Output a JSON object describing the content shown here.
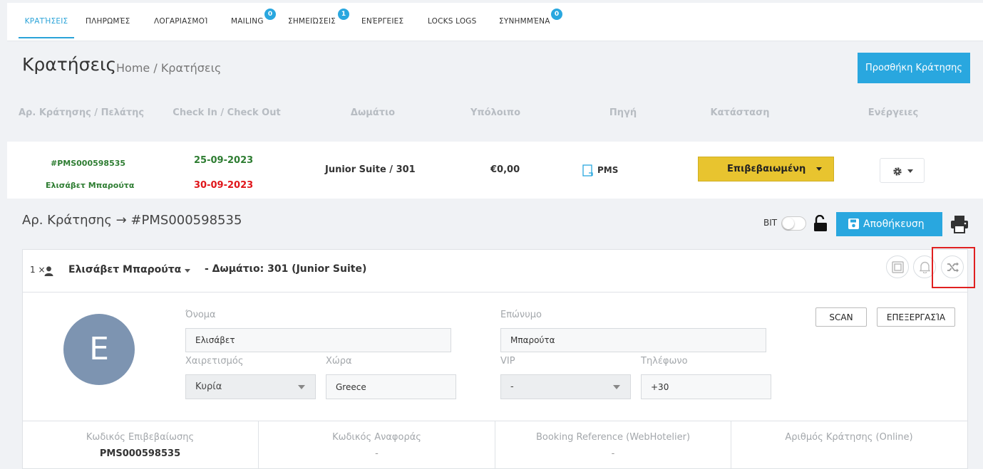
{
  "tabs": [
    {
      "label": "ΚΡΑΤΉΣΕΙΣ"
    },
    {
      "label": "ΠΛΗΡΩΜΈΣ"
    },
    {
      "label": "ΛΟΓΑΡΙΑΣΜΟΊ"
    },
    {
      "label": "MAILING",
      "badge": "0"
    },
    {
      "label": "ΣΗΜΕΙΏΣΕΙΣ",
      "badge": "1"
    },
    {
      "label": "ΕΝΈΡΓΕΙΕΣ"
    },
    {
      "label": "LOCKS LOGS"
    },
    {
      "label": "ΣΥΝΗΜΜΈΝΑ",
      "badge": "0"
    }
  ],
  "header": {
    "title": "Κρατήσεις",
    "breadcrumb": "Home / Κρατήσεις",
    "add_button": "Προσθήκη Κράτησης"
  },
  "table": {
    "columns": [
      "Αρ. Κράτησης / Πελάτης",
      "Check In / Check Out",
      "Δωμάτιο",
      "Υπόλοιπο",
      "Πηγή",
      "Κατάσταση",
      "Ενέργειες"
    ],
    "row": {
      "reservation_no": "#PMS000598535",
      "guest": "Ελισάβετ Μπαρούτα",
      "check_in": "25-09-2023",
      "check_out": "30-09-2023",
      "room": "Junior Suite / 301",
      "balance": "€0,00",
      "source": "PMS",
      "status": "Επιβεβαιωμένη"
    }
  },
  "detail": {
    "title": "Αρ. Κράτησης → #PMS000598535",
    "bit_label": "BIT",
    "save_button": "Αποθήκευση"
  },
  "guest_card": {
    "count": "1 ×",
    "name": "Ελισάβετ Μπαρούτα",
    "room_info": "- Δωμάτιο: 301 (Junior Suite)",
    "avatar_letter": "E",
    "scan_button": "SCAN",
    "edit_button": "ΕΠΕΞΕΡΓΑΣΊΑ",
    "fields": {
      "first_name_label": "Όνομα",
      "first_name": "Ελισάβετ",
      "last_name_label": "Επώνυμο",
      "last_name": "Μπαρούτα",
      "salutation_label": "Χαιρετισμός",
      "salutation": "Κυρία",
      "country_label": "Χώρα",
      "country": "Greece",
      "vip_label": "VIP",
      "vip": "-",
      "phone_label": "Τηλέφωνο",
      "phone": "+30"
    }
  },
  "references": [
    {
      "label": "Κωδικός Επιβεβαίωσης",
      "value": "PMS000598535"
    },
    {
      "label": "Κωδικός Αναφοράς",
      "value": "-"
    },
    {
      "label": "Booking Reference (WebHotelier)",
      "value": "-"
    },
    {
      "label": "Αριθμός Κράτησης (Online)",
      "value": ""
    }
  ],
  "colors": {
    "accent": "#29a7df",
    "status": "#e8c42f",
    "highlight": "#e02020"
  }
}
